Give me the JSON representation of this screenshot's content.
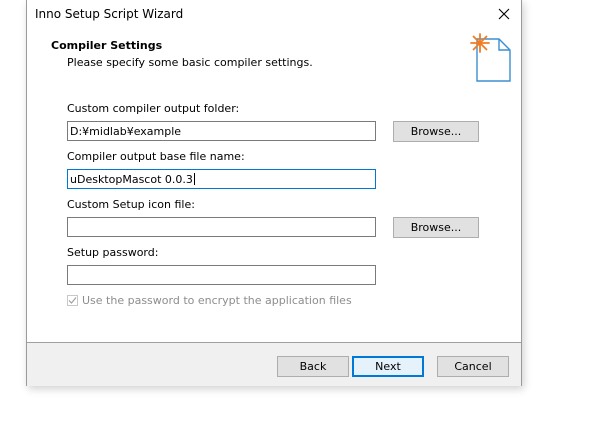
{
  "window": {
    "title": "Inno Setup Script Wizard"
  },
  "header": {
    "title": "Compiler Settings",
    "subtitle": "Please specify some basic compiler settings."
  },
  "fields": {
    "output_folder": {
      "label": "Custom compiler output folder:",
      "value": "D:¥midlab¥example",
      "browse_label": "Browse..."
    },
    "base_file_name": {
      "label": "Compiler output base file name:",
      "value": "uDesktopMascot 0.0.3"
    },
    "setup_icon": {
      "label": "Custom Setup icon file:",
      "value": "",
      "browse_label": "Browse..."
    },
    "setup_password": {
      "label": "Setup password:",
      "value": ""
    },
    "encrypt_checkbox": {
      "label": "Use the password to encrypt the application files",
      "checked": true,
      "disabled": true
    }
  },
  "buttons": {
    "back": "Back",
    "next": "Next",
    "cancel": "Cancel"
  },
  "colors": {
    "accent": "#0078d7",
    "wizard_icon_star": "#f47b20",
    "wizard_icon_page": "#3b8fd0"
  }
}
